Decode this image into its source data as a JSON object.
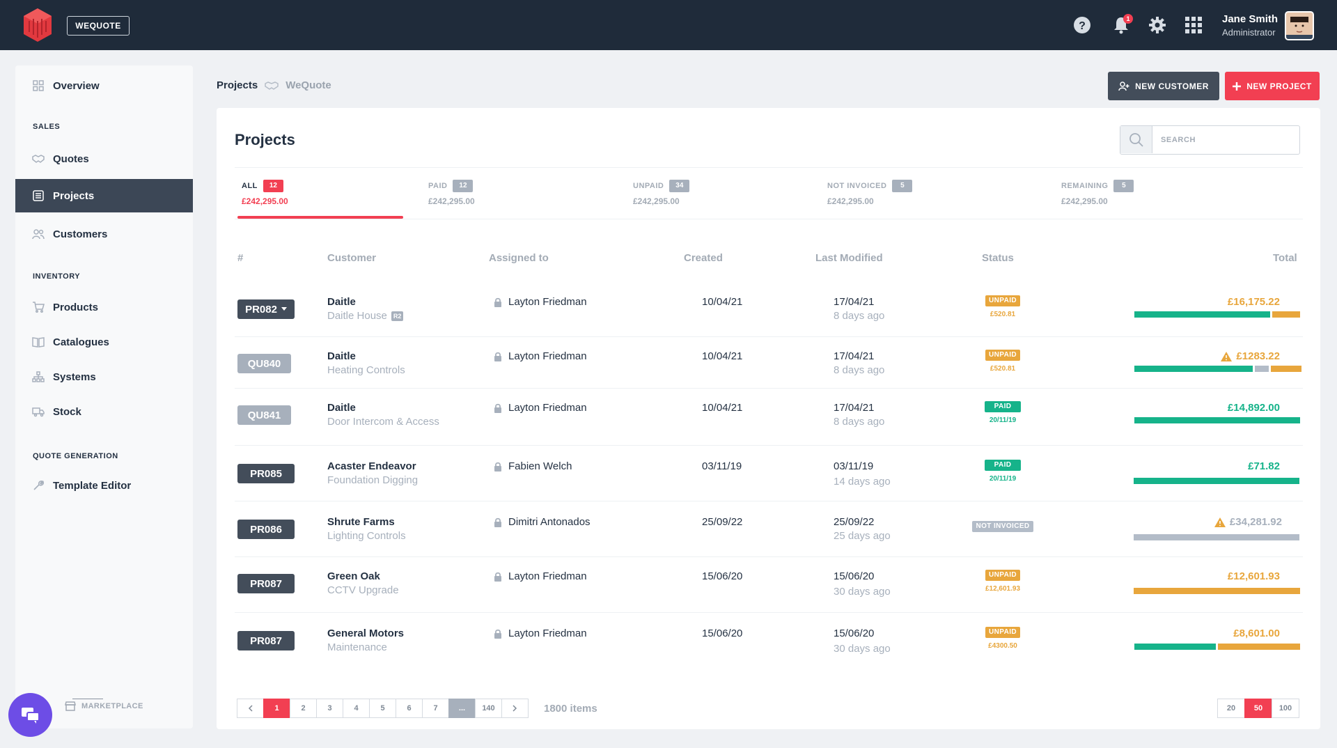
{
  "topbar": {
    "brand_label": "WEQUOTE",
    "notification_count": "1",
    "user_name": "Jane Smith",
    "user_role": "Administrator"
  },
  "sidebar": {
    "overview": "Overview",
    "section_sales": "SALES",
    "quotes": "Quotes",
    "projects": "Projects",
    "customers": "Customers",
    "section_inventory": "INVENTORY",
    "products": "Products",
    "catalogues": "Catalogues",
    "systems": "Systems",
    "stock": "Stock",
    "section_quote_generation": "QUOTE GENERATION",
    "template_editor": "Template Editor",
    "marketplace": "MARKETPLACE"
  },
  "breadcrumb": {
    "root": "Projects",
    "brand": "WeQuote"
  },
  "actions": {
    "new_customer": "NEW CUSTOMER",
    "new_project": "NEW PROJECT"
  },
  "card": {
    "title": "Projects",
    "search_placeholder": "SEARCH"
  },
  "tabs": [
    {
      "label": "ALL",
      "count": "12",
      "amount": "£242,295.00"
    },
    {
      "label": "PAID",
      "count": "12",
      "amount": "£242,295.00"
    },
    {
      "label": "UNPAID",
      "count": "34",
      "amount": "£242,295.00"
    },
    {
      "label": "NOT INVOICED",
      "count": "5",
      "amount": "£242,295.00"
    },
    {
      "label": "REMAINING",
      "count": "5",
      "amount": "£242,295.00"
    }
  ],
  "table": {
    "headers": {
      "id": "#",
      "customer": "Customer",
      "assigned": "Assigned to",
      "created": "Created",
      "modified": "Last Modified",
      "status": "Status",
      "total": "Total"
    },
    "rows": [
      {
        "id": "PR082",
        "customer": "Daitle",
        "sub": "Daitle House",
        "tag": "R2",
        "assigned": "Layton Friedman",
        "created": "10/04/21",
        "modified": "17/04/21",
        "ago": "8 days ago",
        "status": "UNPAID",
        "status_sub": "£520.81",
        "total": "£16,175.22",
        "warning": false
      },
      {
        "id": "QU840",
        "customer": "Daitle",
        "sub": "Heating Controls",
        "assigned": "Layton Friedman",
        "created": "10/04/21",
        "modified": "17/04/21",
        "ago": "8 days ago",
        "status": "UNPAID",
        "status_sub": "£520.81",
        "total": "£1283.22",
        "warning": true
      },
      {
        "id": "QU841",
        "customer": "Daitle",
        "sub": "Door Intercom & Access",
        "assigned": "Layton Friedman",
        "created": "10/04/21",
        "modified": "17/04/21",
        "ago": "8 days ago",
        "status": "PAID",
        "status_sub": "20/11/19",
        "total": "£14,892.00",
        "warning": false
      },
      {
        "id": "PR085",
        "customer": "Acaster Endeavor",
        "sub": "Foundation Digging",
        "assigned": "Fabien Welch",
        "created": "03/11/19",
        "modified": "03/11/19",
        "ago": "14 days ago",
        "status": "PAID",
        "status_sub": "20/11/19",
        "total": "£71.82",
        "warning": false
      },
      {
        "id": "PR086",
        "customer": "Shrute Farms",
        "sub": "Lighting Controls",
        "assigned": "Dimitri Antonados",
        "created": "25/09/22",
        "modified": "25/09/22",
        "ago": "25 days ago",
        "status": "NOT INVOICED",
        "status_sub": "",
        "total": "£34,281.92",
        "warning": true
      },
      {
        "id": "PR087",
        "customer": "Green Oak",
        "sub": "CCTV Upgrade",
        "assigned": "Layton Friedman",
        "created": "15/06/20",
        "modified": "15/06/20",
        "ago": "30 days ago",
        "status": "UNPAID",
        "status_sub": "£12,601.93",
        "total": "£12,601.93",
        "warning": false
      },
      {
        "id": "PR087",
        "customer": "General Motors",
        "sub": "Maintenance",
        "assigned": "Layton Friedman",
        "created": "15/06/20",
        "modified": "15/06/20",
        "ago": "30 days ago",
        "status": "UNPAID",
        "status_sub": "£4300.50",
        "total": "£8,601.00",
        "warning": false
      }
    ]
  },
  "pagination": {
    "pages": [
      "1",
      "2",
      "3",
      "4",
      "5",
      "6",
      "7",
      "...",
      "140"
    ],
    "current": "1",
    "items_label": "1800 items",
    "per_page": [
      "20",
      "50",
      "100"
    ],
    "per_page_selected": "50"
  },
  "colors": {
    "accent": "#f23f52",
    "topbar": "#1f2b3a",
    "paid": "#16b38a",
    "unpaid": "#e8a63c",
    "neutral": "#a7b0bc",
    "chat_button": "#6d4de6"
  },
  "icons": {
    "help": "help-circle-icon",
    "notifications": "bell-icon",
    "settings": "gear-icon",
    "apps": "grid-icon",
    "search": "search-icon",
    "chat": "chat-icon"
  }
}
